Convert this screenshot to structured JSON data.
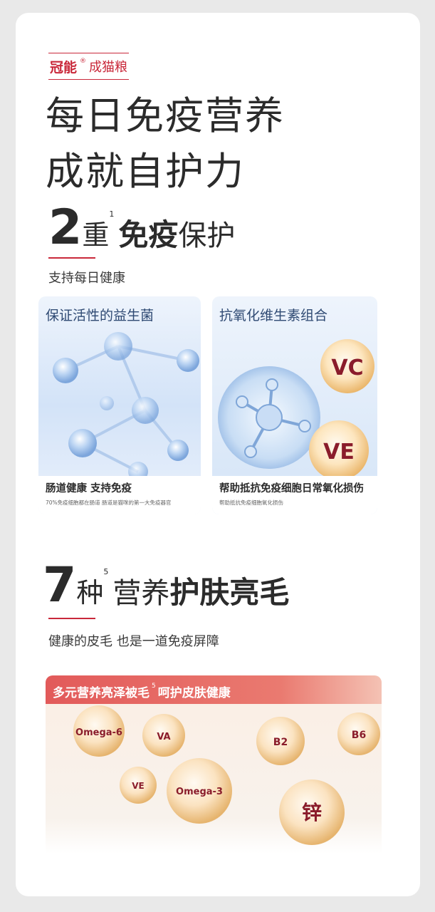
{
  "brand": {
    "name": "冠能",
    "reg": "®",
    "sub": "成猫粮"
  },
  "headline": {
    "line1": "每日免疫营养",
    "line2": "成就自护力"
  },
  "section1": {
    "number": "2",
    "unit": "重",
    "sup": "1",
    "bold": "免疫",
    "rest": "保护",
    "subtitle": "支持每日健康",
    "panels": [
      {
        "title": "保证活性的益生菌",
        "foot_main": "肠道健康  支持免疫",
        "foot_small": "70%免疫细胞都在肠道 肠道是猫咪的第一大免疫器官"
      },
      {
        "title": "抗氧化维生素组合",
        "foot_main": "帮助抵抗免疫细胞日常氧化损伤",
        "foot_small": "帮助抵抗免疫细胞氧化损伤",
        "bubbles": [
          "VC",
          "VE"
        ]
      }
    ]
  },
  "section2": {
    "number": "7",
    "unit": "种",
    "sup": "5",
    "norm": "营养",
    "bold": "护肤亮毛",
    "subtitle": "健康的皮毛 也是一道免疫屏障",
    "band_label_a": "多元营养亮泽被毛",
    "band_sup": "5",
    "band_label_b": "呵护皮肤健康",
    "bubbles": [
      "Omega-6",
      "VA",
      "B2",
      "B6",
      "VE",
      "Omega-3",
      "锌"
    ]
  },
  "colors": {
    "accent": "#c9283a",
    "text": "#2b2b2b",
    "panel_title": "#2f4a73",
    "band": "#e05757"
  }
}
